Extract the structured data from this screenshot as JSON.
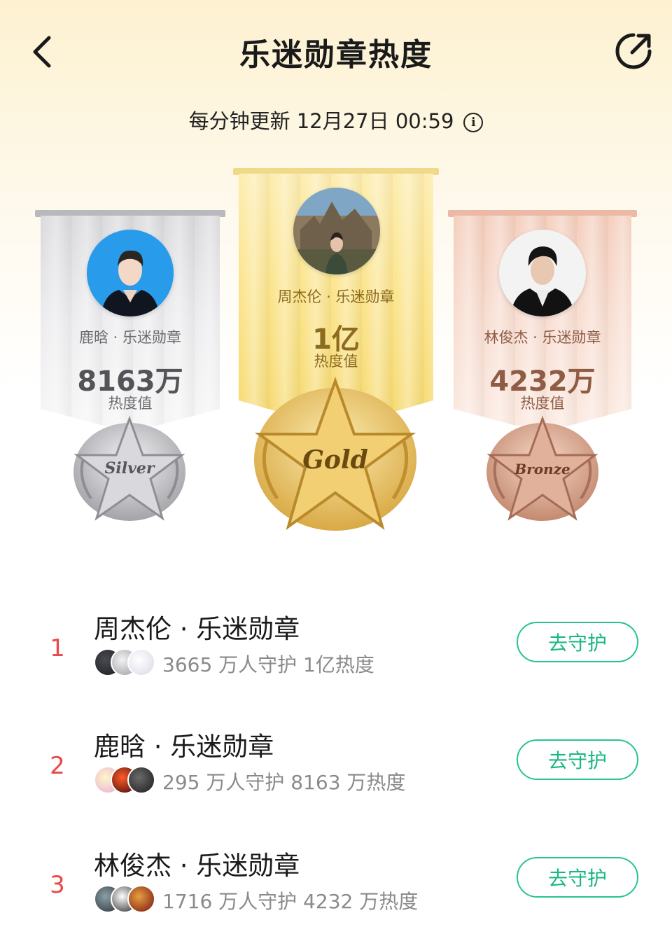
{
  "header": {
    "title": "乐迷勋章热度",
    "back_icon": "chevron-left-icon",
    "share_icon": "share-icon"
  },
  "update": {
    "text": "每分钟更新 12月27日 00:59",
    "info_icon": "info-icon",
    "info_glyph": "i"
  },
  "podium": {
    "silver": {
      "name": "鹿晗 · 乐迷勋章",
      "value": "8163万",
      "unit": "热度值",
      "medal_label": "Silver"
    },
    "gold": {
      "name": "周杰伦 · 乐迷勋章",
      "value": "1亿",
      "unit": "热度值",
      "medal_label": "Gold"
    },
    "bronze": {
      "name": "林俊杰 · 乐迷勋章",
      "value": "4232万",
      "unit": "热度值",
      "medal_label": "Bronze"
    }
  },
  "ranking": [
    {
      "rank": "1",
      "title": "周杰伦 · 乐迷勋章",
      "stats": "3665 万人守护  1亿热度",
      "button": "去守护"
    },
    {
      "rank": "2",
      "title": "鹿晗 · 乐迷勋章",
      "stats": "295 万人守护  8163 万热度",
      "button": "去守护"
    },
    {
      "rank": "3",
      "title": "林俊杰 · 乐迷勋章",
      "stats": "1716 万人守护  4232 万热度",
      "button": "去守护"
    }
  ],
  "colors": {
    "rank": "#e84a4a",
    "button_border": "#27c48e",
    "gold_text": "#8c6a1e",
    "silver_text": "#545458",
    "bronze_text": "#8f5b45"
  }
}
